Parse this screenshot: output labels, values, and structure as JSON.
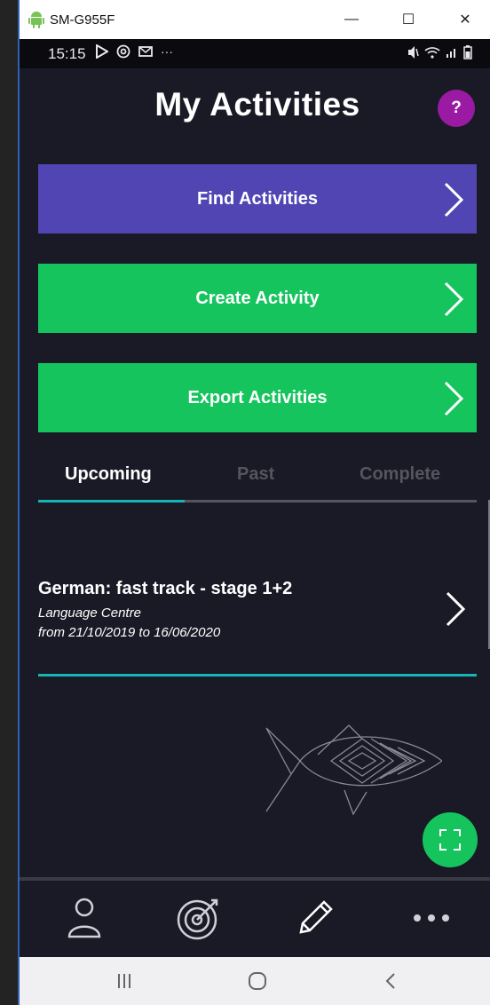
{
  "window": {
    "title": "SM-G955F",
    "minimize": "—",
    "maximize": "☐",
    "close": "✕"
  },
  "status": {
    "time": "15:15",
    "more": "···"
  },
  "page": {
    "title": "My Activities",
    "help": "?"
  },
  "actions": {
    "find": "Find Activities",
    "create": "Create Activity",
    "export": "Export Activities"
  },
  "tabs": {
    "upcoming": "Upcoming",
    "past": "Past",
    "complete": "Complete",
    "active": "Upcoming"
  },
  "activities": [
    {
      "name": "German: fast track - stage 1+2",
      "organisation": "Language Centre",
      "dates": "from 21/10/2019 to 16/06/2020"
    }
  ],
  "bottom_nav": [
    "profile-icon",
    "target-icon",
    "pencil-icon",
    "more-icon"
  ],
  "colors": {
    "background": "#1a1a27",
    "find_button": "#5145b3",
    "green_button": "#16c45e",
    "accent_line": "#17b4b5",
    "help_badge": "#9a1aa3"
  }
}
